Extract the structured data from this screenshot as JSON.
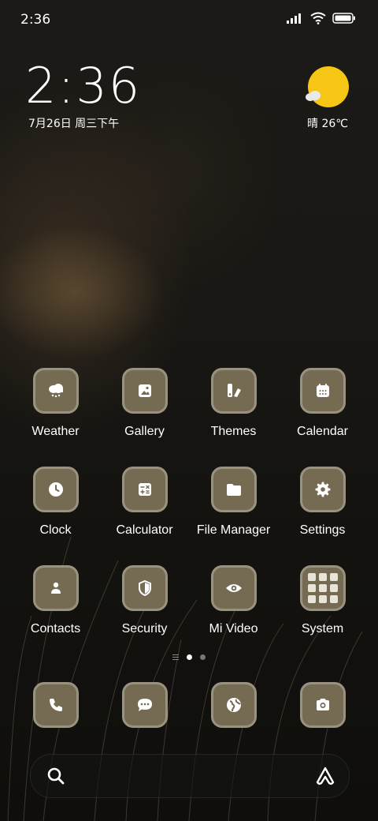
{
  "status_bar": {
    "time": "2:36"
  },
  "clock_widget": {
    "time": "2:36",
    "date": "7月26日 周三下午"
  },
  "weather_widget": {
    "text": "晴 26℃",
    "sun_color": "#f6c615"
  },
  "apps": [
    {
      "label": "Weather",
      "icon": "weather-icon"
    },
    {
      "label": "Gallery",
      "icon": "gallery-icon"
    },
    {
      "label": "Themes",
      "icon": "themes-icon"
    },
    {
      "label": "Calendar",
      "icon": "calendar-icon"
    },
    {
      "label": "Clock",
      "icon": "clock-icon"
    },
    {
      "label": "Calculator",
      "icon": "calculator-icon"
    },
    {
      "label": "File Manager",
      "icon": "folder-icon"
    },
    {
      "label": "Settings",
      "icon": "gear-icon"
    },
    {
      "label": "Contacts",
      "icon": "contacts-icon"
    },
    {
      "label": "Security",
      "icon": "shield-icon"
    },
    {
      "label": "Mi Video",
      "icon": "eye-icon"
    },
    {
      "label": "System",
      "icon": "app-folder-icon"
    }
  ],
  "dock": [
    {
      "icon": "phone-icon"
    },
    {
      "icon": "message-icon"
    },
    {
      "icon": "browser-icon"
    },
    {
      "icon": "camera-icon"
    }
  ],
  "pager": {
    "pages": 2,
    "active": 1
  },
  "colors": {
    "icon_bg": "#756a52",
    "icon_border": "#9a9280"
  }
}
